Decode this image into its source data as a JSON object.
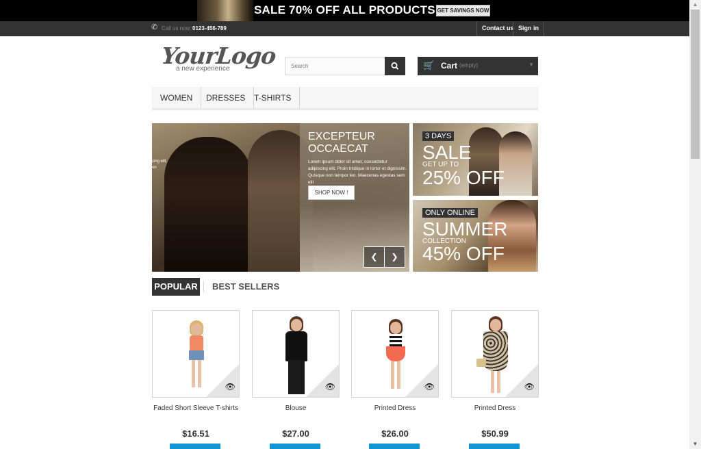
{
  "promo": {
    "text": "SALE 70% OFF ALL PRODUCTS",
    "button": "GET SAVINGS NOW"
  },
  "topnav": {
    "call_label": "Call us now:",
    "call_number": "0123-456-789",
    "contact": "Contact us",
    "signin": "Sign in"
  },
  "logo": {
    "text": "YourLogo",
    "tagline": "a new experience"
  },
  "search": {
    "placeholder": "Search"
  },
  "cart": {
    "label": "Cart",
    "status": "(empty)"
  },
  "menu": [
    "WOMEN",
    "DRESSES",
    "T-SHIRTS"
  ],
  "slider": {
    "title": "EXCEPTEUR OCCAECAT",
    "text": "Lorem ipsum dolor sit amet, consectetur adipiscing elit. Proin tristique in tortor et dignissim. Quisque non tempor leo. Maecenas egestas sem elit",
    "cut_text": "cing elit.",
    "cut_text_2": "on",
    "button": "SHOP NOW !"
  },
  "banners": [
    {
      "tag": "3 DAYS",
      "headline": "SALE",
      "sub": "GET UP TO",
      "percent": "25% OFF"
    },
    {
      "tag": "ONLY ONLINE",
      "headline": "SUMMER",
      "sub": "COLLECTION",
      "percent": "45% OFF"
    }
  ],
  "tabs": {
    "popular": "POPULAR",
    "best_sellers": "BEST SELLERS"
  },
  "products": [
    {
      "name": "Faded Short Sleeve T-shirts",
      "price": "$16.51"
    },
    {
      "name": "Blouse",
      "price": "$27.00"
    },
    {
      "name": "Printed Dress",
      "price": "$26.00"
    },
    {
      "name": "Printed Dress",
      "price": "$50.99"
    }
  ],
  "icons": {
    "phone": "phone-icon",
    "search": "search-icon",
    "cart": "cart-icon",
    "eye": "eye-icon"
  },
  "colors": {
    "dark": "#333333",
    "accent": "#1196d3",
    "menu_bg": "#f6f6f6"
  }
}
